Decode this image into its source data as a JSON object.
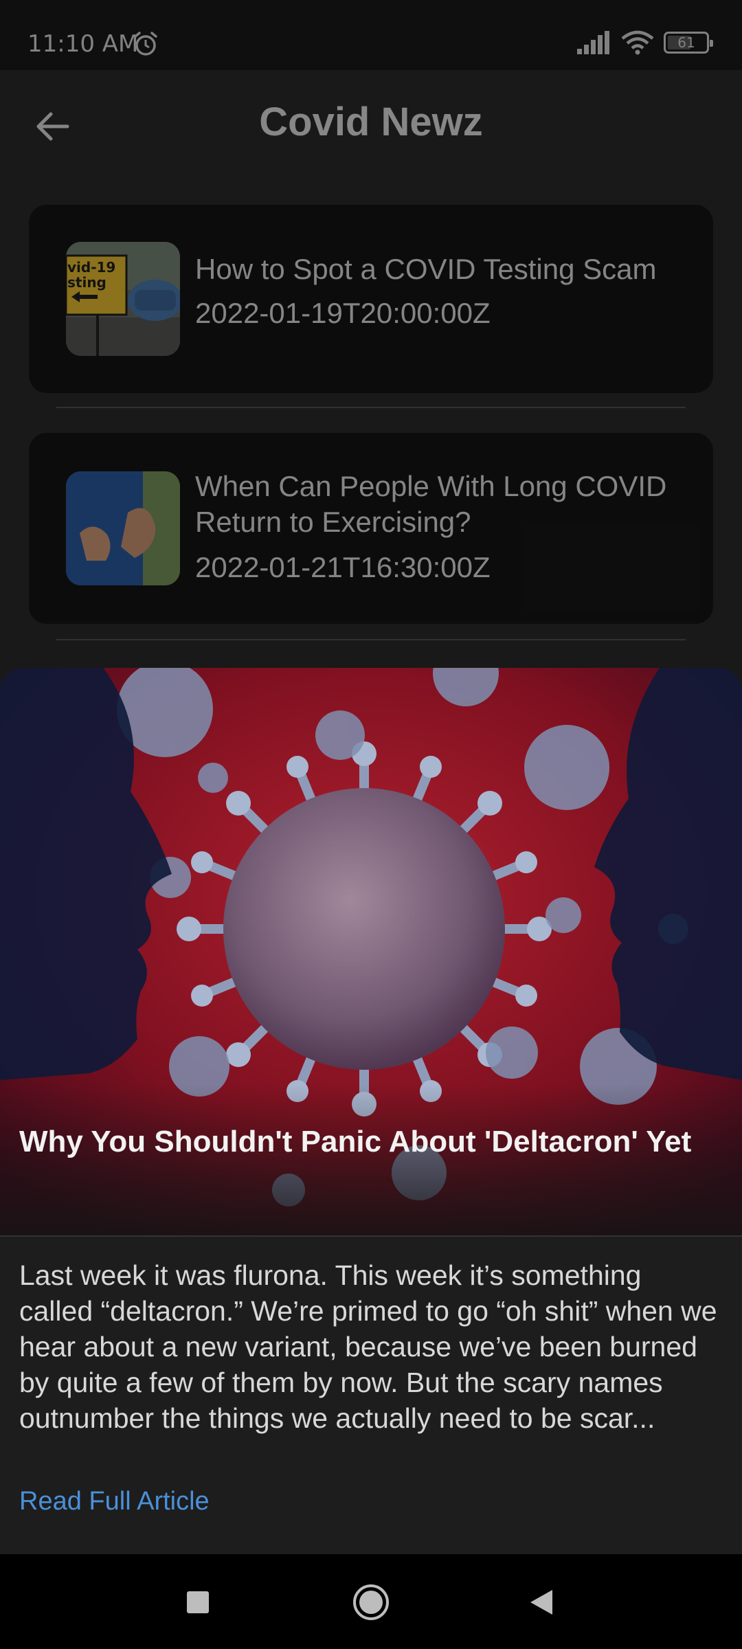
{
  "status_bar": {
    "time": "11:10 AM",
    "battery_level": "61",
    "battery_percent": 61,
    "icons": [
      "alarm-icon",
      "signal-icon",
      "wifi-icon",
      "battery-icon"
    ]
  },
  "app_bar": {
    "title": "Covid Newz",
    "back_icon": "arrow-left-icon"
  },
  "articles": [
    {
      "title": "How to Spot a COVID Testing Scam",
      "date": "2022-01-19T20:00:00Z"
    },
    {
      "title": "When Can People With Long COVID Return to Exercising?",
      "date": "2022-01-21T16:30:00Z"
    }
  ],
  "detail_sheet": {
    "title": "Why You Shouldn't Panic About 'Deltacron' Yet",
    "summary": "Last week it was flurona. This week it’s something called “deltacron.” We’re primed to go “oh shit” when we hear about a new variant, because we’ve been burned by quite a few of them by now. But the scary names outnumber the things we actually need to be scar...",
    "link_label": "Read Full Article"
  },
  "nav_bar": {
    "buttons": [
      "recents-square-icon",
      "home-circle-icon",
      "back-triangle-icon"
    ]
  },
  "colors": {
    "link": "#4a90d9",
    "background": "#2b2b2b",
    "card": "#161616",
    "sheet": "#1d1d1d"
  }
}
